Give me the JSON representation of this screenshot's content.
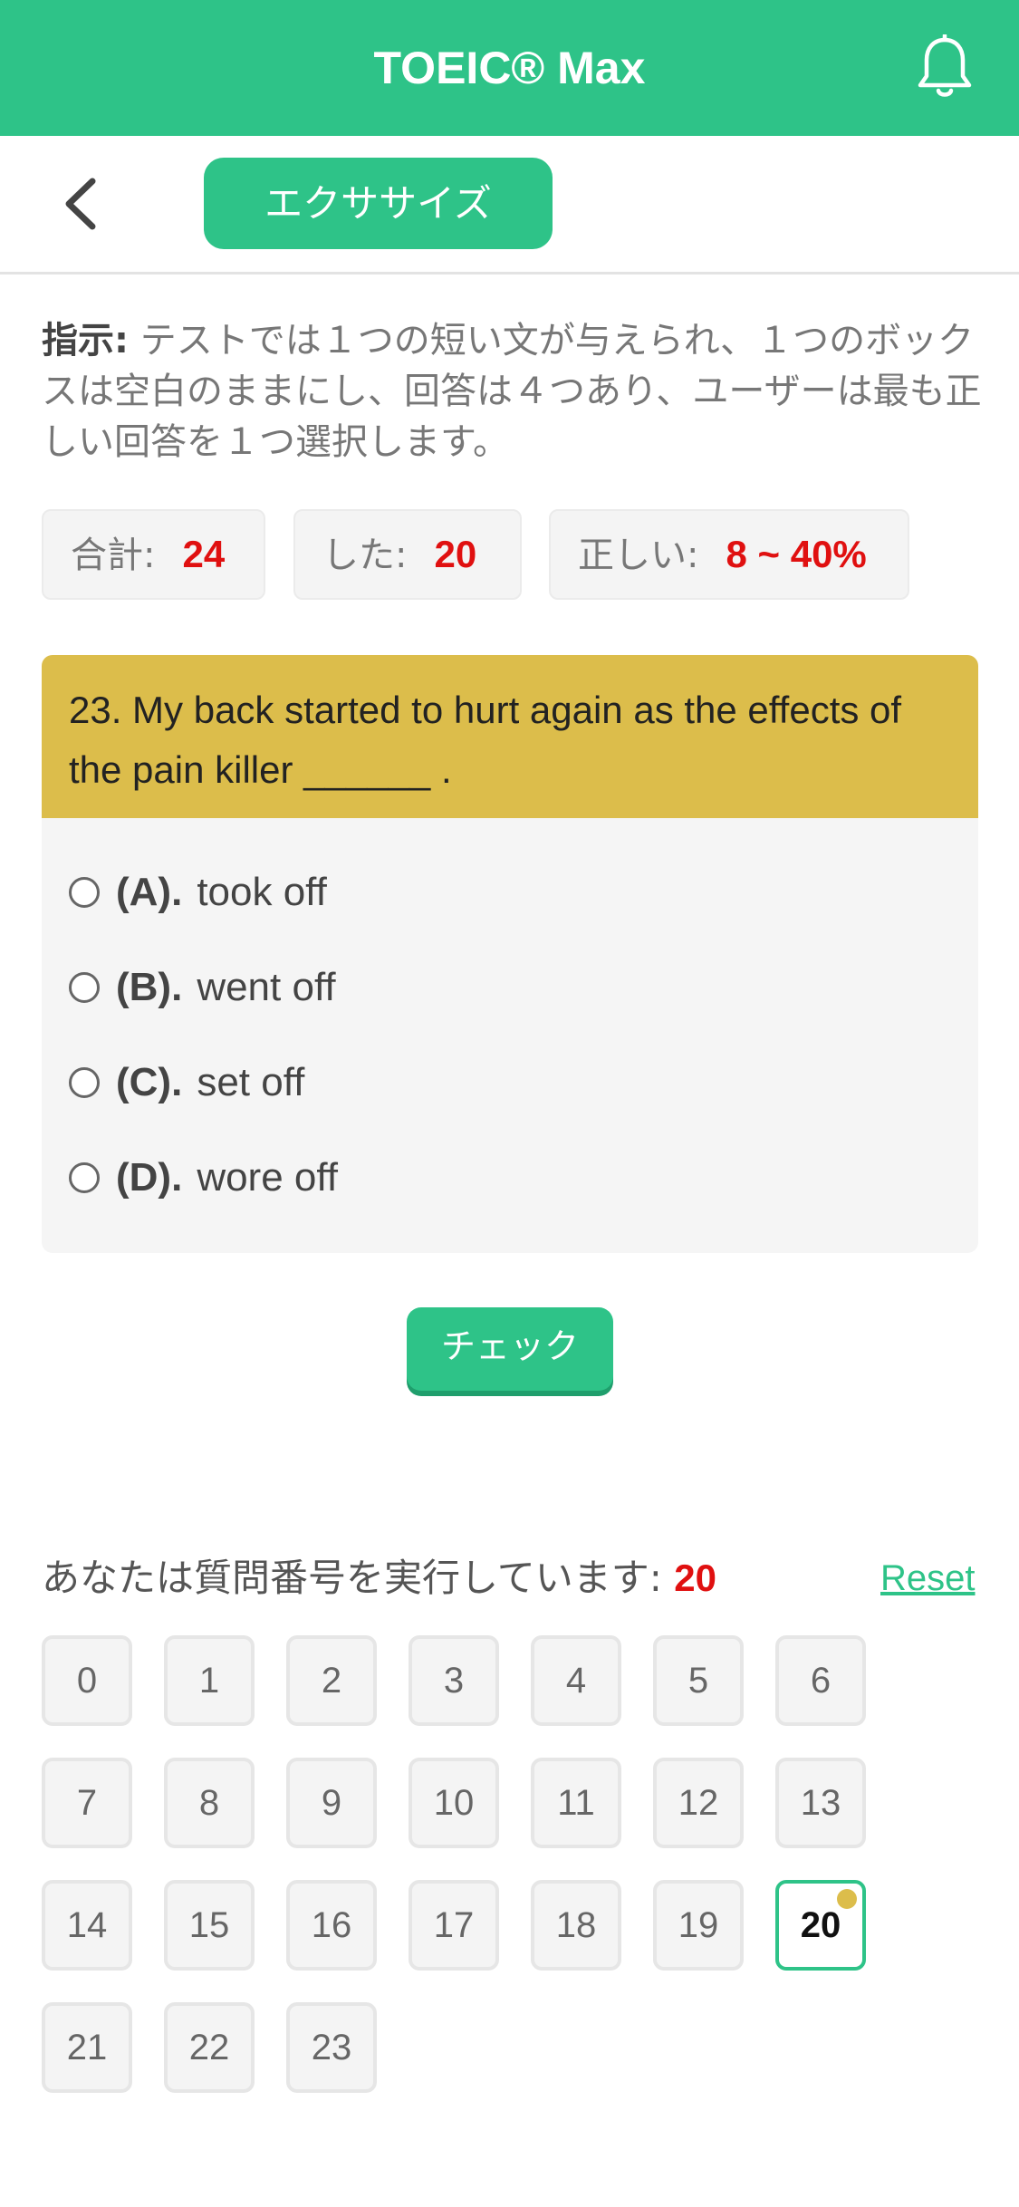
{
  "app": {
    "title": "TOEIC® Max",
    "accent_color": "#2ec388",
    "question_header_color": "#dcbd4b",
    "highlight_color": "#e01010"
  },
  "subbar": {
    "section_label": "エクササイズ"
  },
  "instructions": {
    "label": "指示:",
    "text": "テストでは１つの短い文が与えられ、１つのボックスは空白のままにし、回答は４つあり、ユーザーは最も正しい回答を１つ選択します。"
  },
  "stats": [
    {
      "label": "合計:",
      "value": "24"
    },
    {
      "label": "した:",
      "value": "20"
    },
    {
      "label": "正しい:",
      "value": "8 ~ 40%"
    }
  ],
  "question": {
    "text": "23. My back started to hurt again as the effects of the pain killer ______ .",
    "options": [
      {
        "letter": "(A).",
        "text": "took off"
      },
      {
        "letter": "(B).",
        "text": "went off"
      },
      {
        "letter": "(C).",
        "text": "set off"
      },
      {
        "letter": "(D).",
        "text": "wore off"
      }
    ]
  },
  "check_label": "チェック",
  "progress": {
    "label": "あなたは質問番号を実行しています:",
    "current": "20",
    "reset_label": "Reset"
  },
  "question_numbers": [
    "0",
    "1",
    "2",
    "3",
    "4",
    "5",
    "6",
    "7",
    "8",
    "9",
    "10",
    "11",
    "12",
    "13",
    "14",
    "15",
    "16",
    "17",
    "18",
    "19",
    "20",
    "21",
    "22",
    "23"
  ],
  "current_question": "20"
}
